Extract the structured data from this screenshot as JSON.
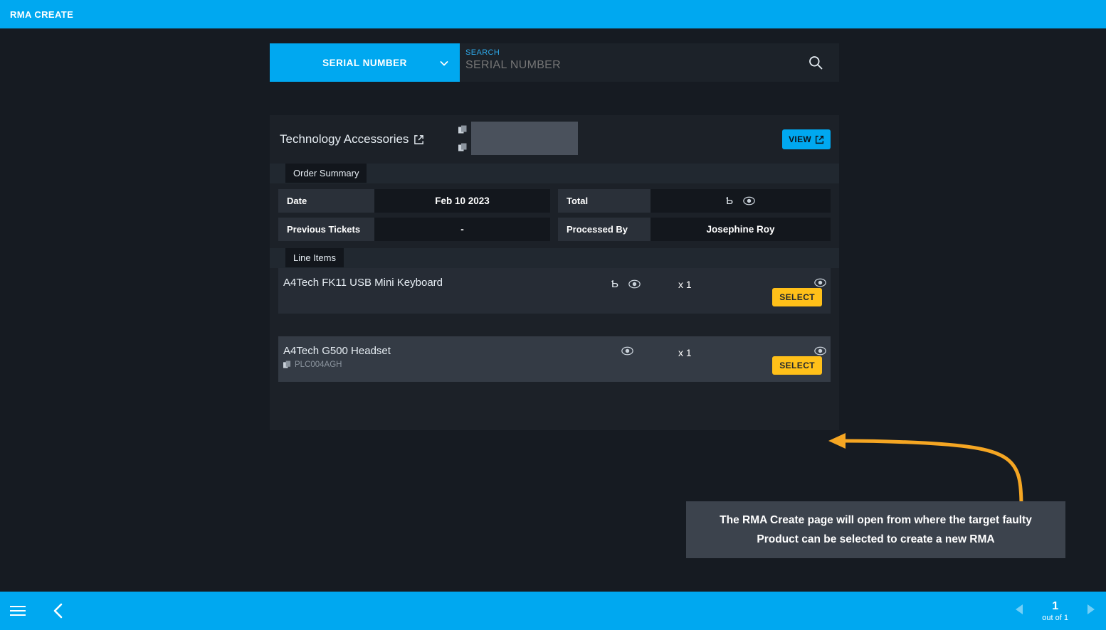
{
  "header": {
    "title": "RMA CREATE"
  },
  "search": {
    "type_label": "SERIAL NUMBER",
    "field_label": "SEARCH",
    "placeholder": "SERIAL NUMBER",
    "value": "",
    "search_icon": "search-icon",
    "chevron_icon": "chevron-down-icon"
  },
  "card": {
    "customer_name": "Technology Accessories",
    "external_link_icon": "external-link-icon",
    "redacted_field": "",
    "copy_icon": "copy-icon",
    "view_button": "VIEW"
  },
  "order_summary": {
    "section_title": "Order Summary",
    "rows": [
      {
        "k1": "Date",
        "v1": "Feb 10 2023",
        "k2": "Total",
        "v2": "",
        "v2_masked": true,
        "currency_glyph": "Ƅ"
      },
      {
        "k1": "Previous Tickets",
        "v1": "-",
        "k2": "Processed By",
        "v2": "Josephine Roy",
        "v2_masked": false
      }
    ]
  },
  "line_items": {
    "section_title": "Line Items",
    "select_label": "SELECT",
    "eye_icon": "eye-icon",
    "tag_icon": "tag-icon",
    "items": [
      {
        "name": "A4Tech FK11 USB Mini Keyboard",
        "serial": "",
        "currency_glyph": "Ƅ",
        "has_price": true,
        "quantity": "x 1",
        "selected": false
      },
      {
        "name": "A4Tech G500 Headset",
        "serial": "PLC004AGH",
        "currency_glyph": "",
        "has_price": false,
        "quantity": "x 1",
        "selected": true
      }
    ]
  },
  "callout": {
    "text": "The RMA Create page will open from where the target faulty Product can be selected to create a new RMA",
    "arrow_color": "#F5A623"
  },
  "bottom_bar": {
    "menu_icon": "hamburger-menu-icon",
    "back_icon": "chevron-left-icon",
    "prev_icon": "triangle-left-icon",
    "next_icon": "triangle-right-icon",
    "page_number": "1",
    "page_total": "out of 1"
  },
  "colors": {
    "accent_blue": "#00A8F0",
    "select_amber": "#FFC019",
    "page_bg": "#161b22",
    "card_bg": "#1c2128",
    "row_bg": "#262c35",
    "row_selected_bg": "#343b45",
    "callout_bg": "#3c434d"
  }
}
